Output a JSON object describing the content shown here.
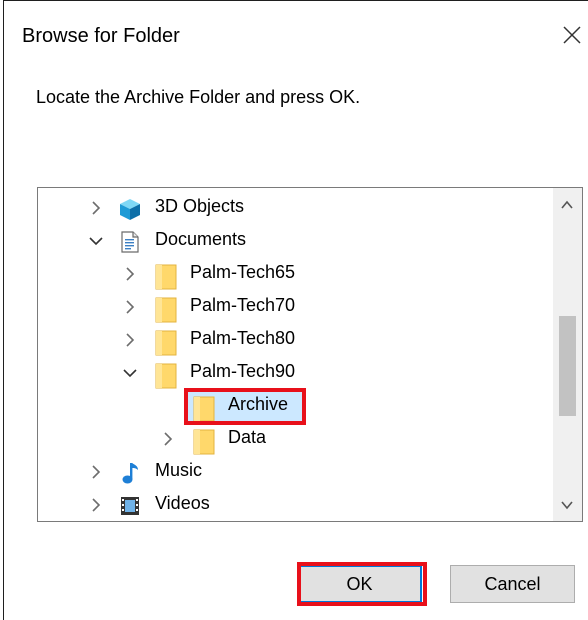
{
  "dialog": {
    "title": "Browse for Folder",
    "message": "Locate the Archive Folder and press OK.",
    "ok_label": "OK",
    "cancel_label": "Cancel"
  },
  "tree": {
    "items": [
      {
        "label": "3D Objects",
        "chevron": "collapsed",
        "icon": "3d-objects-icon"
      },
      {
        "label": "Documents",
        "chevron": "expanded",
        "icon": "documents-icon"
      },
      {
        "label": "Palm-Tech65",
        "chevron": "collapsed",
        "icon": "folder-icon"
      },
      {
        "label": "Palm-Tech70",
        "chevron": "collapsed",
        "icon": "folder-icon"
      },
      {
        "label": "Palm-Tech80",
        "chevron": "collapsed",
        "icon": "folder-icon"
      },
      {
        "label": "Palm-Tech90",
        "chevron": "expanded",
        "icon": "folder-icon"
      },
      {
        "label": "Archive",
        "chevron": "none",
        "icon": "folder-icon",
        "selected": true
      },
      {
        "label": "Data",
        "chevron": "collapsed",
        "icon": "folder-icon"
      },
      {
        "label": "Music",
        "chevron": "collapsed",
        "icon": "music-icon"
      },
      {
        "label": "Videos",
        "chevron": "collapsed",
        "icon": "videos-icon"
      }
    ]
  },
  "colors": {
    "selection": "#cce8ff",
    "highlight_box": "#e8101a",
    "default_button_border": "#0078d7",
    "folder": "#ffd86b"
  }
}
